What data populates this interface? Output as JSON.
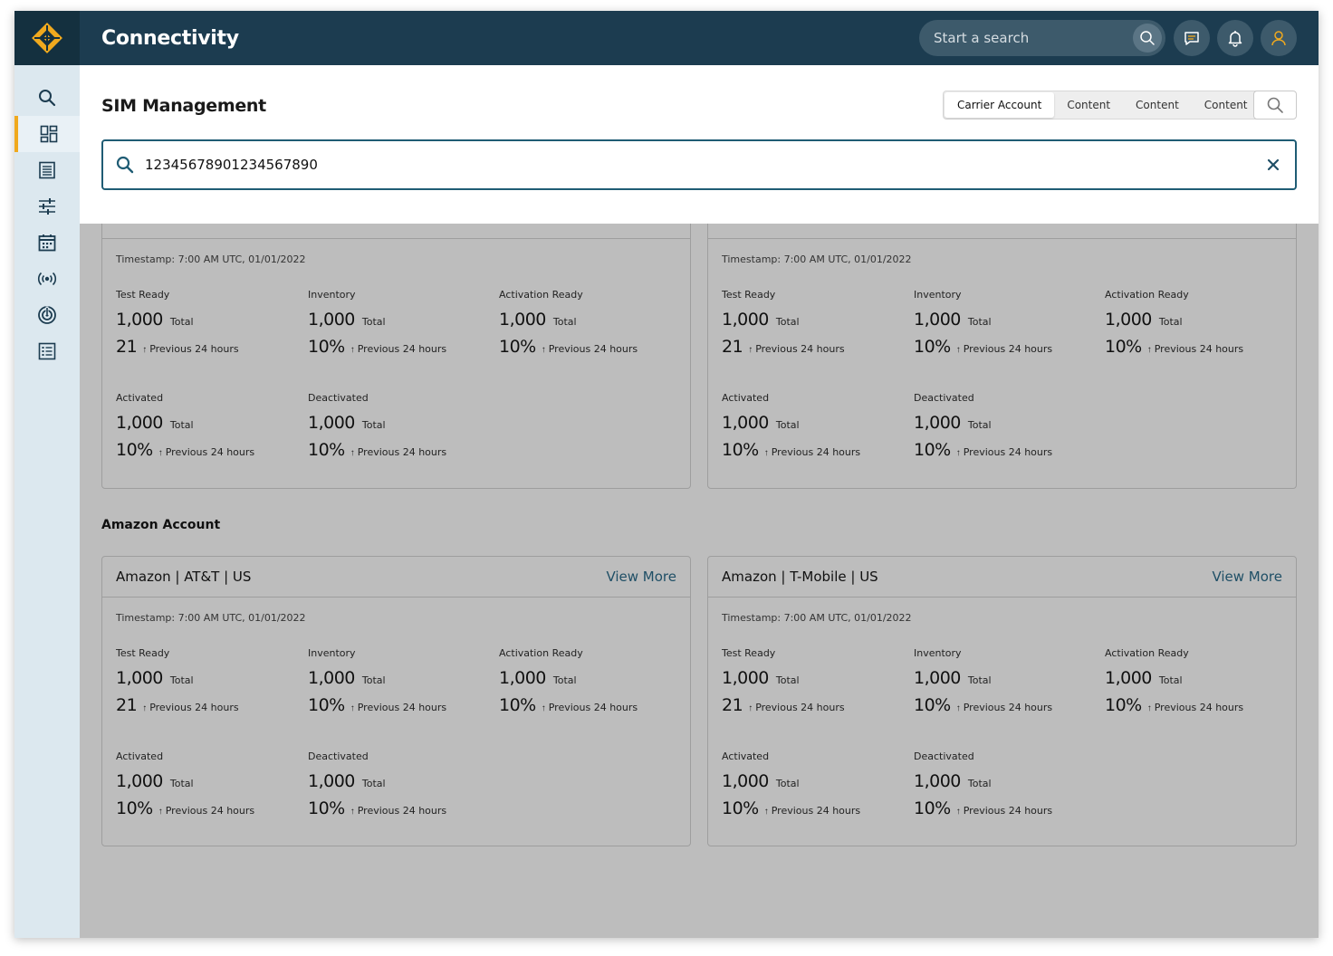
{
  "app": {
    "title": "Connectivity",
    "accent": "#f0a91e",
    "brand": "#1c3c50"
  },
  "topbar": {
    "search_placeholder": "Start a search",
    "icons": [
      "search-icon",
      "message-icon",
      "bell-icon",
      "user-icon"
    ]
  },
  "sidebar": {
    "items": [
      "search-icon",
      "dashboard-icon",
      "document-list-icon",
      "sliders-icon",
      "calendar-icon",
      "signal-tower-icon",
      "radar-icon",
      "list-icon"
    ],
    "active_index": 1,
    "collapse_icon": "collapse-menu-icon"
  },
  "page": {
    "title": "SIM Management",
    "tabs": [
      {
        "label": "Carrier Account",
        "selected": true
      },
      {
        "label": "Content",
        "selected": false
      },
      {
        "label": "Content",
        "selected": false
      },
      {
        "label": "Content",
        "selected": false
      }
    ],
    "search_value": "12345678901234567890"
  },
  "section": {
    "title": "Amazon Account"
  },
  "cards": [
    {
      "title": "",
      "view_more": "",
      "timestamp": "Timestamp: 7:00 AM UTC, 01/01/2022",
      "metrics": [
        {
          "label": "Test Ready",
          "total": "1,000",
          "total_unit": "Total",
          "change": "21",
          "change_label": "Previous 24 hours"
        },
        {
          "label": "Inventory",
          "total": "1,000",
          "total_unit": "Total",
          "change": "10%",
          "change_label": "Previous 24 hours"
        },
        {
          "label": "Activation Ready",
          "total": "1,000",
          "total_unit": "Total",
          "change": "10%",
          "change_label": "Previous 24 hours"
        },
        {
          "label": "Activated",
          "total": "1,000",
          "total_unit": "Total",
          "change": "10%",
          "change_label": "Previous 24 hours"
        },
        {
          "label": "Deactivated",
          "total": "1,000",
          "total_unit": "Total",
          "change": "10%",
          "change_label": "Previous 24 hours"
        }
      ]
    },
    {
      "title": "",
      "view_more": "",
      "timestamp": "Timestamp: 7:00 AM UTC, 01/01/2022",
      "metrics": [
        {
          "label": "Test Ready",
          "total": "1,000",
          "total_unit": "Total",
          "change": "21",
          "change_label": "Previous 24 hours"
        },
        {
          "label": "Inventory",
          "total": "1,000",
          "total_unit": "Total",
          "change": "10%",
          "change_label": "Previous 24 hours"
        },
        {
          "label": "Activation Ready",
          "total": "1,000",
          "total_unit": "Total",
          "change": "10%",
          "change_label": "Previous 24 hours"
        },
        {
          "label": "Activated",
          "total": "1,000",
          "total_unit": "Total",
          "change": "10%",
          "change_label": "Previous 24 hours"
        },
        {
          "label": "Deactivated",
          "total": "1,000",
          "total_unit": "Total",
          "change": "10%",
          "change_label": "Previous 24 hours"
        }
      ]
    },
    {
      "title": "Amazon | AT&T | US",
      "view_more": "View More",
      "timestamp": "Timestamp: 7:00 AM UTC, 01/01/2022",
      "metrics": [
        {
          "label": "Test Ready",
          "total": "1,000",
          "total_unit": "Total",
          "change": "21",
          "change_label": "Previous 24 hours"
        },
        {
          "label": "Inventory",
          "total": "1,000",
          "total_unit": "Total",
          "change": "10%",
          "change_label": "Previous 24 hours"
        },
        {
          "label": "Activation Ready",
          "total": "1,000",
          "total_unit": "Total",
          "change": "10%",
          "change_label": "Previous 24 hours"
        },
        {
          "label": "Activated",
          "total": "1,000",
          "total_unit": "Total",
          "change": "10%",
          "change_label": "Previous 24 hours"
        },
        {
          "label": "Deactivated",
          "total": "1,000",
          "total_unit": "Total",
          "change": "10%",
          "change_label": "Previous 24 hours"
        }
      ]
    },
    {
      "title": "Amazon | T-Mobile | US",
      "view_more": "View More",
      "timestamp": "Timestamp: 7:00 AM UTC, 01/01/2022",
      "metrics": [
        {
          "label": "Test Ready",
          "total": "1,000",
          "total_unit": "Total",
          "change": "21",
          "change_label": "Previous 24 hours"
        },
        {
          "label": "Inventory",
          "total": "1,000",
          "total_unit": "Total",
          "change": "10%",
          "change_label": "Previous 24 hours"
        },
        {
          "label": "Activation Ready",
          "total": "1,000",
          "total_unit": "Total",
          "change": "10%",
          "change_label": "Previous 24 hours"
        },
        {
          "label": "Activated",
          "total": "1,000",
          "total_unit": "Total",
          "change": "10%",
          "change_label": "Previous 24 hours"
        },
        {
          "label": "Deactivated",
          "total": "1,000",
          "total_unit": "Total",
          "change": "10%",
          "change_label": "Previous 24 hours"
        }
      ]
    }
  ]
}
